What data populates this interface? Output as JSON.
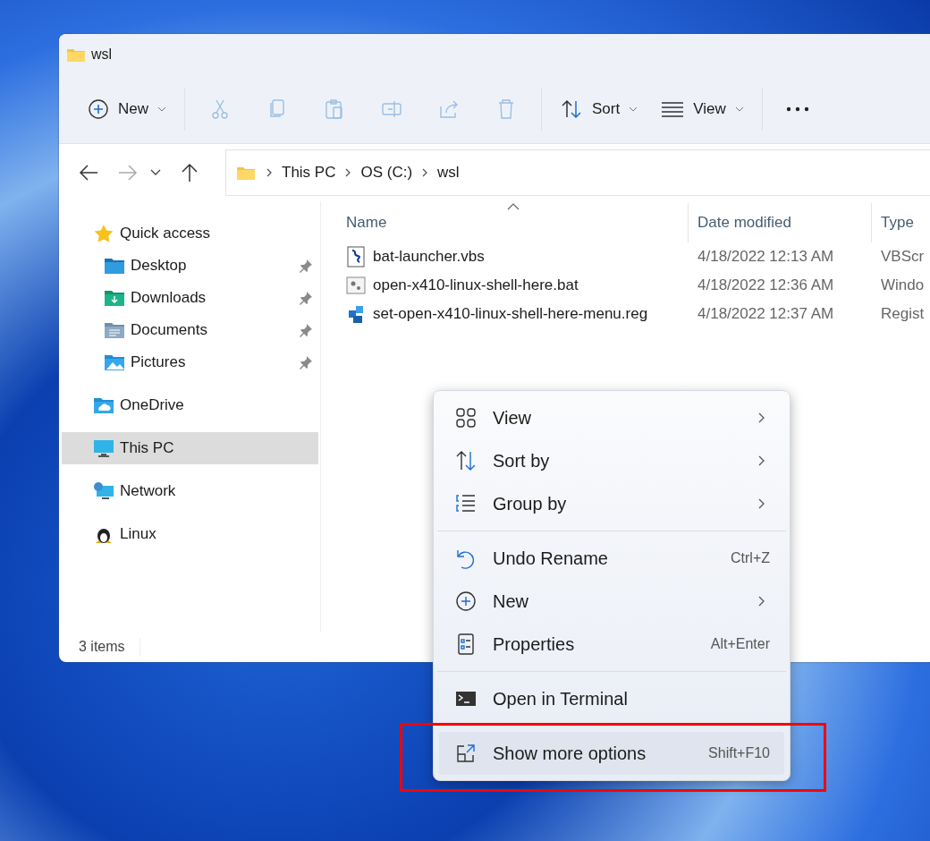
{
  "window": {
    "title": "wsl"
  },
  "toolbar": {
    "new": {
      "label": "New"
    },
    "actions": [
      {
        "kind": "cut",
        "disabled": true
      },
      {
        "kind": "copy",
        "disabled": true
      },
      {
        "kind": "paste",
        "disabled": true
      },
      {
        "kind": "rename",
        "disabled": true
      },
      {
        "kind": "share",
        "disabled": true
      },
      {
        "kind": "delete",
        "disabled": true
      }
    ],
    "sort": {
      "label": "Sort"
    },
    "view": {
      "label": "View"
    }
  },
  "navigation": {
    "back_disabled": false,
    "forward_disabled": true
  },
  "address": {
    "crumbs": [
      "This PC",
      "OS (C:)",
      "wsl"
    ]
  },
  "sidebar": {
    "items": [
      {
        "label": "Quick access",
        "kind": "star",
        "selected": false,
        "children": [
          {
            "label": "Desktop",
            "kind": "desktop",
            "pinned": true,
            "selected": false
          },
          {
            "label": "Downloads",
            "kind": "downloads",
            "pinned": true,
            "selected": false
          },
          {
            "label": "Documents",
            "kind": "documents",
            "pinned": true,
            "selected": false
          },
          {
            "label": "Pictures",
            "kind": "pictures",
            "pinned": true,
            "selected": false
          }
        ]
      },
      {
        "label": "OneDrive",
        "kind": "cloud",
        "selected": false
      },
      {
        "label": "This PC",
        "kind": "pc",
        "selected": true
      },
      {
        "label": "Network",
        "kind": "network",
        "selected": false
      },
      {
        "label": "Linux",
        "kind": "penguin",
        "selected": false
      }
    ]
  },
  "table": {
    "columns": [
      "Name",
      "Date modified",
      "Type"
    ],
    "rows": [
      {
        "name": "bat-launcher.vbs",
        "date": "4/18/2022 12:13 AM",
        "type": "VBScr",
        "kind": "script"
      },
      {
        "name": "open-x410-linux-shell-here.bat",
        "date": "4/18/2022 12:36 AM",
        "type": "Windo",
        "kind": "batch"
      },
      {
        "name": "set-open-x410-linux-shell-here-menu.reg",
        "date": "4/18/2022 12:37 AM",
        "type": "Regist",
        "kind": "registry"
      }
    ]
  },
  "status_bar": {
    "count": "3 items"
  },
  "context_menu": {
    "sections": [
      [
        {
          "label": "View",
          "kind": "grid",
          "submenu": true,
          "selected": false
        },
        {
          "label": "Sort by",
          "kind": "sort",
          "submenu": true,
          "selected": false
        },
        {
          "label": "Group by",
          "kind": "group",
          "submenu": true,
          "selected": false
        }
      ],
      [
        {
          "label": "Undo Rename",
          "kind": "undo",
          "shortcut": "Ctrl+Z",
          "submenu": false,
          "selected": false
        },
        {
          "label": "New",
          "kind": "new",
          "submenu": true,
          "selected": false
        },
        {
          "label": "Properties",
          "kind": "properties",
          "shortcut": "Alt+Enter",
          "submenu": false,
          "selected": false
        }
      ],
      [
        {
          "label": "Open in Terminal",
          "kind": "terminal",
          "submenu": false,
          "selected": false
        }
      ],
      [
        {
          "label": "Show more options",
          "kind": "more",
          "shortcut": "Shift+F10",
          "submenu": false,
          "selected": true
        }
      ]
    ]
  }
}
